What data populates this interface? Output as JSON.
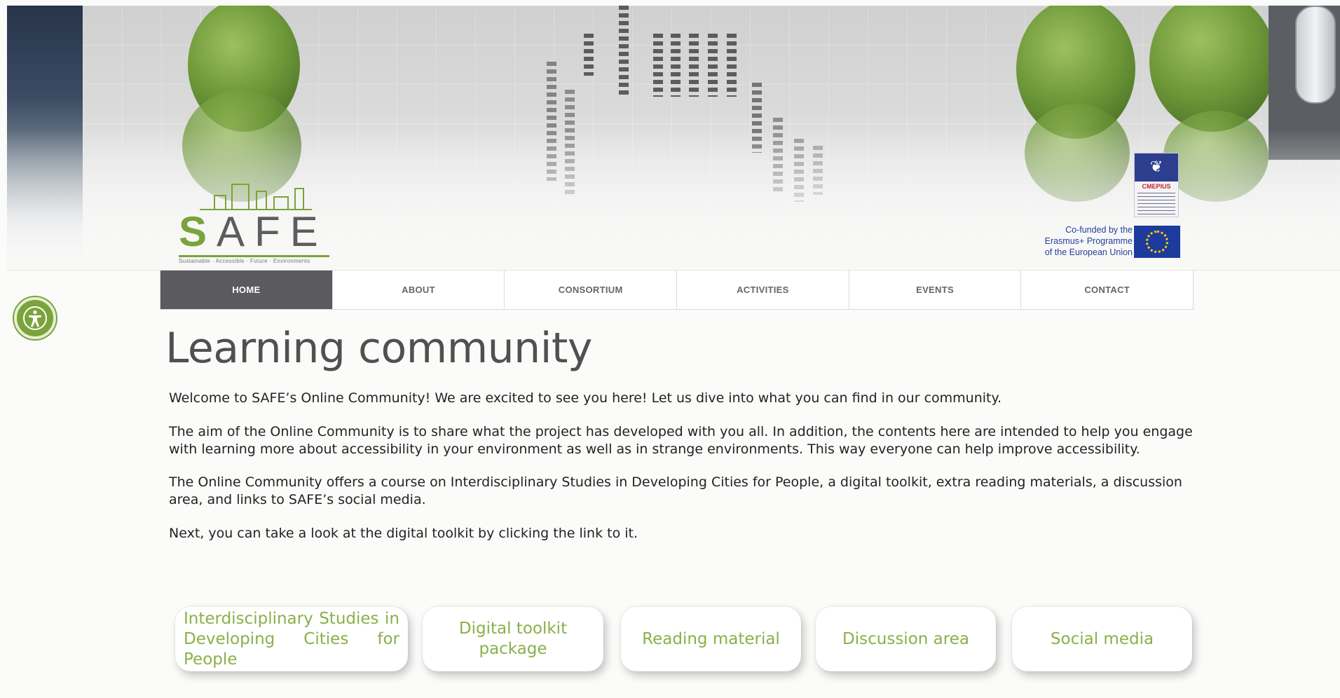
{
  "brand": {
    "logo_text": "SAFE",
    "logo_tagline": "Sustainable · Accessible · Future · Environments"
  },
  "partners": {
    "cmepius_name": "CMEPIUS",
    "cofunded_line1": "Co-funded by the",
    "cofunded_line2": "Erasmus+ Programme",
    "cofunded_line3": "of the European Union"
  },
  "nav": {
    "items": [
      {
        "label": "HOME",
        "active": true
      },
      {
        "label": "ABOUT",
        "active": false
      },
      {
        "label": "CONSORTIUM",
        "active": false
      },
      {
        "label": "ACTIVITIES",
        "active": false
      },
      {
        "label": "EVENTS",
        "active": false
      },
      {
        "label": "CONTACT",
        "active": false
      }
    ]
  },
  "page": {
    "title": "Learning community",
    "paragraphs": [
      "Welcome to SAFE’s Online Community! We are excited to see you here! Let us dive into what you can find in our community.",
      "The aim of the Online Community is to share what the project has developed with you all. In addition, the contents here are intended to help you engage with learning more about accessibility in your environment as well as in strange environments. This way everyone can help improve accessibility.",
      "The Online Community offers a course on Interdisciplinary Studies in Developing Cities for People, a digital toolkit, extra reading materials, a discussion area, and links to SAFE’s social media.",
      "Next, you can take a look at the digital toolkit by clicking the link to it."
    ]
  },
  "cards": [
    {
      "label": "Interdisciplinary Studies in Developing Cities for People"
    },
    {
      "label": "Digital toolkit package"
    },
    {
      "label": "Reading material"
    },
    {
      "label": "Discussion area"
    },
    {
      "label": "Social media"
    }
  ],
  "colors": {
    "accent_green": "#7aa33a",
    "card_text": "#8ab04a",
    "nav_active_bg": "#5a5a5f",
    "eu_blue": "#1d3b9c"
  },
  "icons": {
    "accessibility": "accessibility-icon"
  }
}
